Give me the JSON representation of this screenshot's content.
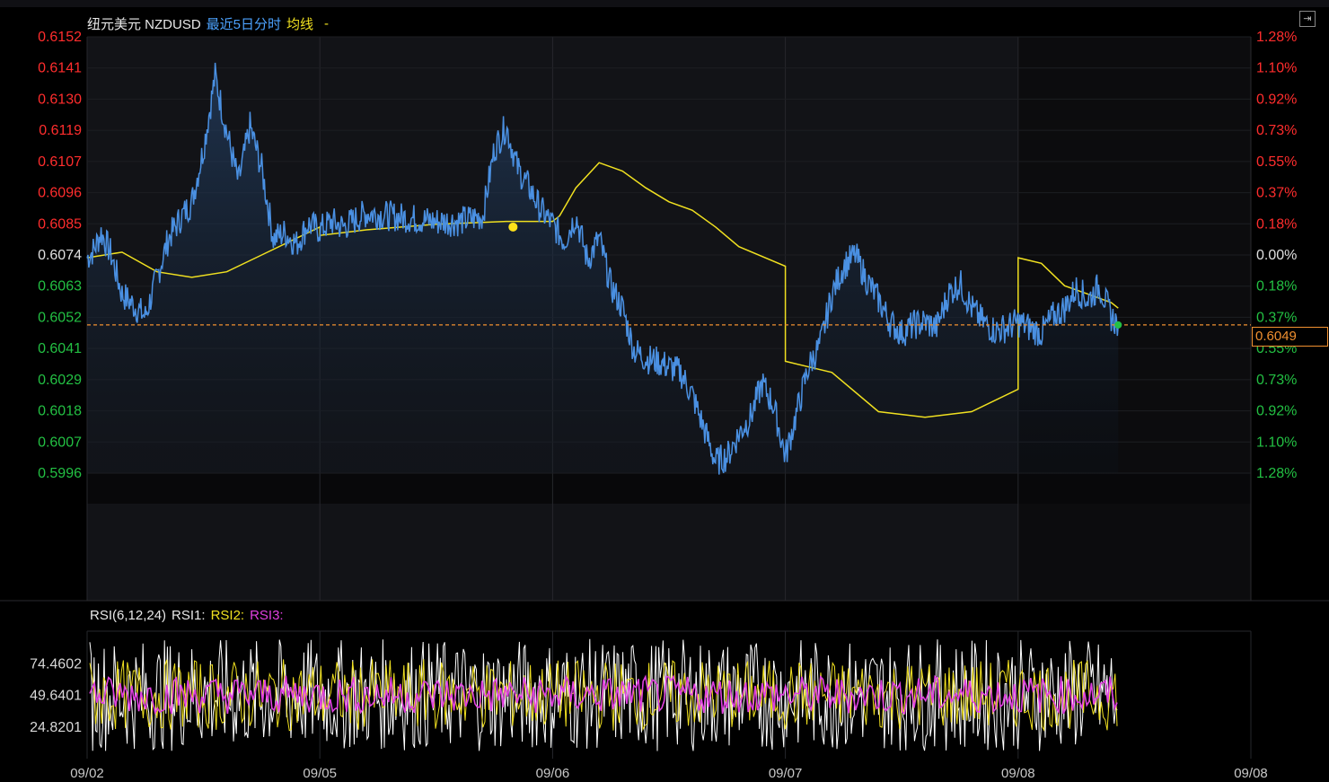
{
  "header": {
    "name": "纽元美元 NZDUSD",
    "mode": "最近5日分时",
    "ma_label": "均线",
    "ma_value": "-"
  },
  "rsi_header": {
    "name": "RSI(6,12,24)",
    "rsi1": "RSI1:",
    "rsi2": "RSI2:",
    "rsi3": "RSI3:"
  },
  "current_price": "0.6049",
  "colors": {
    "price_line": "#4a90e2",
    "ma_line": "#f0e020",
    "up": "#ff2d2d",
    "down": "#23c043",
    "rsi1": "#ffffff",
    "rsi2": "#f0e020",
    "rsi3": "#e040e0",
    "current_price": "#f09030"
  },
  "chart_data": [
    {
      "type": "line",
      "ylim": [
        0.5996,
        0.6152
      ],
      "x_ticks": [
        "09/02",
        "09/05",
        "09/06",
        "09/07",
        "09/08",
        "09/08"
      ],
      "y_ticks_left": [
        "0.6152",
        "0.6141",
        "0.6130",
        "0.6119",
        "0.6107",
        "0.6096",
        "0.6085",
        "0.6074",
        "0.6063",
        "0.6052",
        "0.6041",
        "0.6029",
        "0.6018",
        "0.6007",
        "0.5996"
      ],
      "y_ticks_right": [
        "1.28%",
        "1.10%",
        "0.92%",
        "0.73%",
        "0.55%",
        "0.37%",
        "0.18%",
        "0.00%",
        "0.18%",
        "0.37%",
        "0.55%",
        "0.73%",
        "0.92%",
        "1.10%",
        "1.28%"
      ],
      "reference_price": 0.6049,
      "series": [
        {
          "name": "NZDUSD",
          "x_unit": "trading-day index (0-5)",
          "x": [
            0,
            0.03,
            0.06,
            0.1,
            0.15,
            0.2,
            0.25,
            0.3,
            0.35,
            0.4,
            0.45,
            0.5,
            0.55,
            0.6,
            0.65,
            0.7,
            0.75,
            0.8,
            0.85,
            0.9,
            0.95,
            1.0,
            1.05,
            1.1,
            1.2,
            1.3,
            1.4,
            1.5,
            1.6,
            1.7,
            1.75,
            1.8,
            1.85,
            1.9,
            1.95,
            2.0,
            2.05,
            2.1,
            2.15,
            2.2,
            2.25,
            2.3,
            2.35,
            2.4,
            2.45,
            2.5,
            2.55,
            2.6,
            2.65,
            2.7,
            2.75,
            2.8,
            2.85,
            2.9,
            2.95,
            3.0,
            3.05,
            3.1,
            3.15,
            3.2,
            3.25,
            3.3,
            3.35,
            3.4,
            3.45,
            3.5,
            3.55,
            3.6,
            3.65,
            3.7,
            3.75,
            3.8,
            3.85,
            3.9,
            3.95,
            4.0,
            4.05,
            4.1,
            4.15,
            4.2,
            4.25,
            4.3,
            4.35,
            4.4,
            4.43
          ],
          "y": [
            0.6073,
            0.6076,
            0.6082,
            0.6075,
            0.606,
            0.6056,
            0.6052,
            0.6066,
            0.608,
            0.6087,
            0.6093,
            0.6112,
            0.6138,
            0.6118,
            0.61,
            0.612,
            0.6105,
            0.608,
            0.6082,
            0.6078,
            0.6085,
            0.6083,
            0.6086,
            0.6084,
            0.6089,
            0.6088,
            0.6087,
            0.6086,
            0.6086,
            0.6088,
            0.6112,
            0.612,
            0.6105,
            0.6098,
            0.609,
            0.6085,
            0.6079,
            0.6088,
            0.6072,
            0.608,
            0.6063,
            0.6055,
            0.604,
            0.6037,
            0.6036,
            0.6034,
            0.6032,
            0.6024,
            0.6012,
            0.6,
            0.6002,
            0.601,
            0.6016,
            0.6028,
            0.602,
            0.6002,
            0.6018,
            0.6034,
            0.6042,
            0.606,
            0.607,
            0.6074,
            0.6065,
            0.6058,
            0.605,
            0.6046,
            0.6049,
            0.605,
            0.6048,
            0.606,
            0.6064,
            0.6055,
            0.605,
            0.6047,
            0.6048,
            0.605,
            0.6048,
            0.6046,
            0.6052,
            0.6055,
            0.6062,
            0.6058,
            0.6063,
            0.6052,
            0.6049
          ]
        },
        {
          "name": "均线",
          "x": [
            0,
            0.15,
            0.3,
            0.45,
            0.6,
            0.75,
            0.9,
            1.0,
            1.0,
            1.2,
            1.5,
            1.8,
            2.0,
            2.03,
            2.1,
            2.2,
            2.3,
            2.4,
            2.5,
            2.6,
            2.7,
            2.8,
            3.0,
            3.0,
            3.2,
            3.4,
            3.6,
            3.8,
            4.0,
            4.0,
            4.1,
            4.2,
            4.3,
            4.4,
            4.43
          ],
          "y": [
            0.6073,
            0.6075,
            0.6068,
            0.6066,
            0.6068,
            0.6074,
            0.608,
            0.6084,
            0.6081,
            0.6083,
            0.6085,
            0.6086,
            0.6086,
            0.6088,
            0.6098,
            0.6107,
            0.6104,
            0.6098,
            0.6093,
            0.609,
            0.6084,
            0.6077,
            0.607,
            0.6036,
            0.6032,
            0.6018,
            0.6016,
            0.6018,
            0.6026,
            0.6073,
            0.6071,
            0.6063,
            0.606,
            0.6057,
            0.6055
          ]
        }
      ]
    },
    {
      "type": "line",
      "title": "RSI(6,12,24)",
      "ylim": [
        0,
        100
      ],
      "y_ticks": [
        "74.4602",
        "49.6401",
        "24.8201"
      ],
      "y_tick_values": [
        74.4602,
        49.6401,
        24.8201
      ],
      "series": [
        {
          "name": "RSI1",
          "style": "noisy oscillation ~50 between ~10 and ~95"
        },
        {
          "name": "RSI2",
          "style": "oscillation ~50 between ~25 and ~80"
        },
        {
          "name": "RSI3",
          "style": "oscillation ~50 between ~35 and ~65"
        }
      ]
    }
  ]
}
